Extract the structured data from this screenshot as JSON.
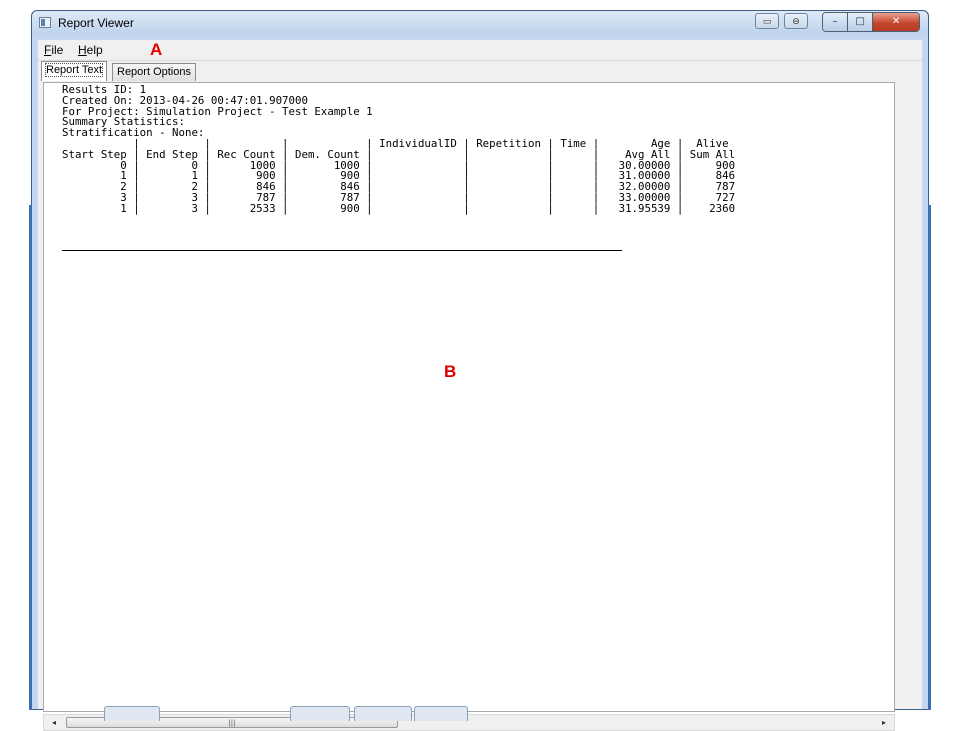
{
  "window": {
    "title": "Report Viewer",
    "extra_buttons": [
      "▭",
      "⊖"
    ],
    "caption_buttons": {
      "minimize": "–",
      "maximize": "□",
      "close": "✕"
    }
  },
  "menu": [
    {
      "label": "File",
      "mnemonic": "F",
      "rest": "ile"
    },
    {
      "label": "Help",
      "mnemonic": "H",
      "rest": "elp"
    }
  ],
  "annotations": {
    "a": "A",
    "b": "B"
  },
  "tabs": [
    {
      "label": "Report Text",
      "active": true
    },
    {
      "label": "Report Options",
      "active": false
    }
  ],
  "report": {
    "lines": [
      "Results ID: 1",
      "Created On: 2013-04-26 00:47:01.907000",
      "For Project: Simulation Project - Test Example 1",
      "Summary Statistics:",
      "Stratification - None:",
      "           |          |           |            | IndividualID | Repetition | Time |        Age |  Alive",
      "Start Step | End Step | Rec Count | Dem. Count |              |            |      |    Avg All | Sum All",
      "         0 |        0 |      1000 |       1000 |              |            |      |   30.00000 |     900",
      "         1 |        1 |       900 |        900 |              |            |      |   31.00000 |     846",
      "         2 |        2 |       846 |        846 |              |            |      |   32.00000 |     787",
      "         3 |        3 |       787 |        787 |              |            |      |   33.00000 |     727",
      "         1 |        3 |      2533 |        900 |              |            |      |   31.95539 |    2360"
    ]
  },
  "scrollbar": {
    "left_arrow": "◂",
    "right_arrow": "▸",
    "grip": "|||"
  }
}
